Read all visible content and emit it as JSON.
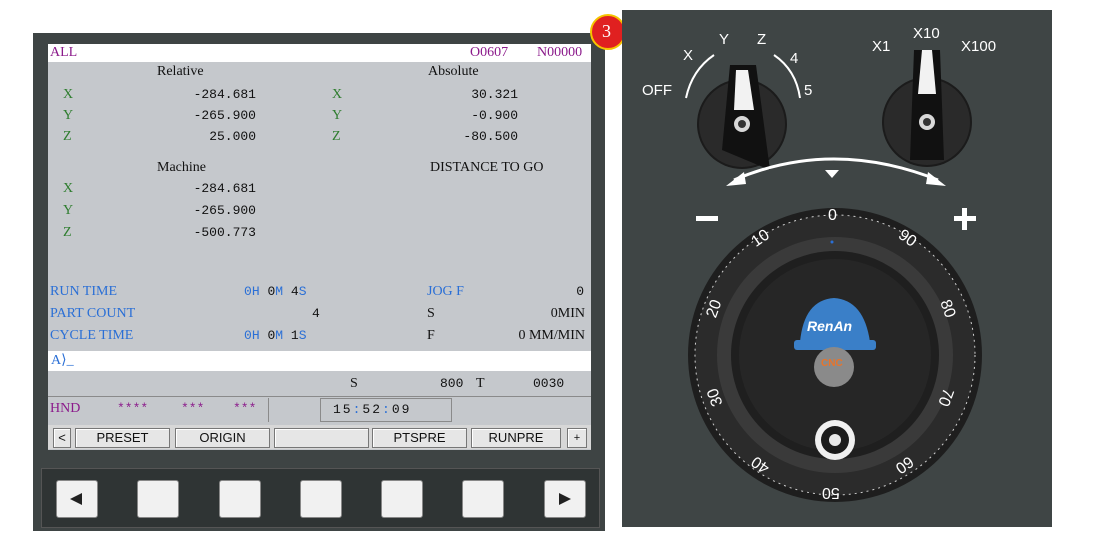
{
  "header": {
    "mode": "ALL",
    "program": "O0607",
    "sequence": "N00000"
  },
  "badge": "3",
  "positions": {
    "relative_title": "Relative",
    "absolute_title": "Absolute",
    "machine_title": "Machine",
    "dtg_title": "DISTANCE TO GO",
    "relative": [
      {
        "axis": "X",
        "value": "-284.681"
      },
      {
        "axis": "Y",
        "value": "-265.900"
      },
      {
        "axis": "Z",
        "value": "25.000"
      }
    ],
    "absolute": [
      {
        "axis": "X",
        "value": "30.321"
      },
      {
        "axis": "Y",
        "value": "-0.900"
      },
      {
        "axis": "Z",
        "value": "-80.500"
      }
    ],
    "machine": [
      {
        "axis": "X",
        "value": "-284.681"
      },
      {
        "axis": "Y",
        "value": "-265.900"
      },
      {
        "axis": "Z",
        "value": "-500.773"
      }
    ]
  },
  "info": {
    "run_time_label": "RUN TIME",
    "run_h": "0",
    "run_m": "0",
    "run_s": "4",
    "part_count_label": "PART COUNT",
    "part_count": "4",
    "cycle_time_label": "CYCLE TIME",
    "cyc_h": "0",
    "cyc_m": "0",
    "cyc_s": "1",
    "unit_h": "H",
    "unit_m": "M",
    "unit_s": "S",
    "jog_label": "JOG F",
    "jog_value": "0",
    "s_label": "S",
    "s_value": "0MIN",
    "f_label": "F",
    "f_value": "0 MM/MIN"
  },
  "input_prompt": "A⟩_",
  "status": {
    "s_label": "S",
    "s_value": "800",
    "t_label": "T",
    "t_value": "0030",
    "mode": "HND",
    "stars1": "****",
    "stars2": "***",
    "stars3": "***",
    "time_h": "15",
    "time_m": "52",
    "time_s": "09",
    "colon": ":"
  },
  "softkeys": {
    "prev": "<",
    "k1": "PRESET",
    "k2": "ORIGIN",
    "k3": "",
    "k4": "PTSPRE",
    "k5": "RUNPRE",
    "next": "+"
  },
  "panel": {
    "axis_labels": [
      "OFF",
      "X",
      "Y",
      "Z",
      "4",
      "5"
    ],
    "step_labels": [
      "X1",
      "X10",
      "X100"
    ],
    "minus": "−",
    "plus": "+",
    "dial_numbers": [
      "0",
      "10",
      "20",
      "30",
      "40",
      "50",
      "60",
      "70",
      "80",
      "90"
    ],
    "logo_text": "RenAn",
    "logo_sub": "CNC"
  }
}
